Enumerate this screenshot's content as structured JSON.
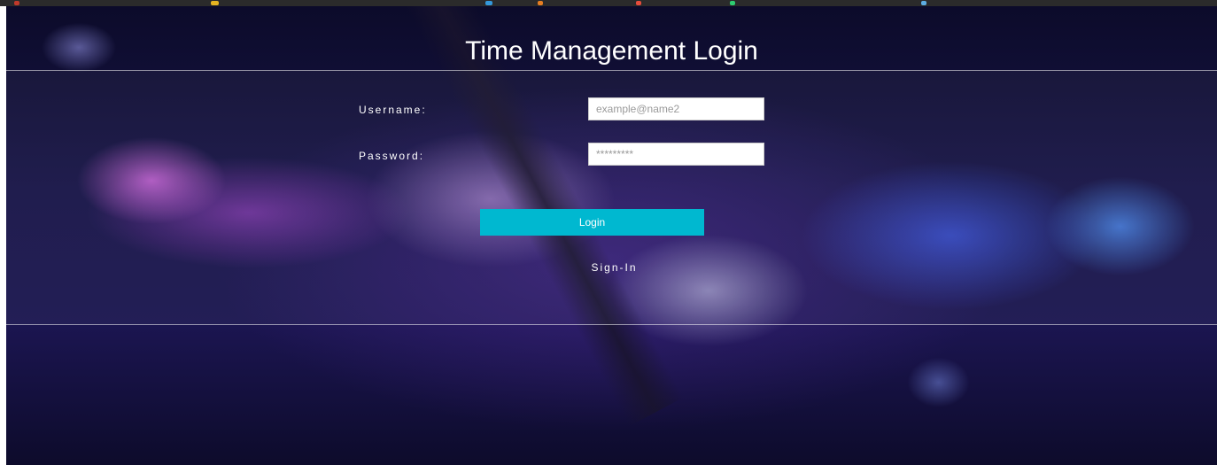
{
  "page": {
    "title": "Time Management Login"
  },
  "form": {
    "username_label": "Username:",
    "username_placeholder": "example@name2",
    "password_label": "Password:",
    "password_placeholder": "*********",
    "login_label": "Login",
    "signin_label": "Sign-In"
  },
  "colors": {
    "accent": "#00b8d0"
  }
}
